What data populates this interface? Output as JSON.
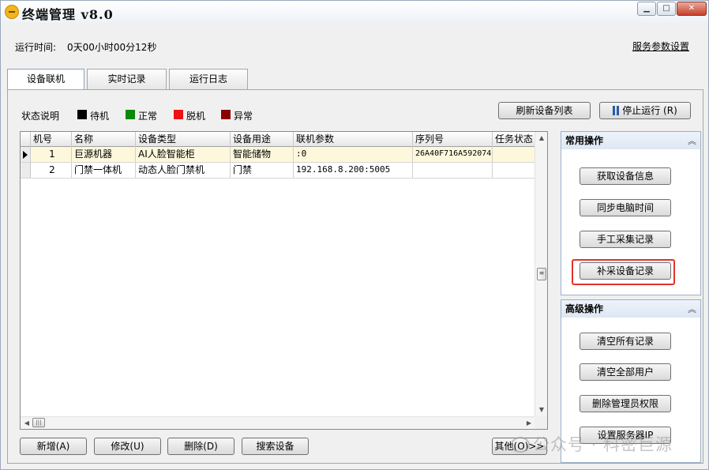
{
  "window": {
    "title": "终端管理 v8.0",
    "controls": [
      "minimize",
      "maximize",
      "close"
    ]
  },
  "status": {
    "runtime_label": "运行时间:",
    "runtime_value": "0天00小时00分12秒",
    "service_settings_link": "服务参数设置"
  },
  "tabs": [
    {
      "label": "设备联机",
      "active": true
    },
    {
      "label": "实时记录",
      "active": false
    },
    {
      "label": "运行日志",
      "active": false
    }
  ],
  "legend": {
    "title": "状态说明",
    "items": [
      {
        "label": "待机",
        "color": "#000000"
      },
      {
        "label": "正常",
        "color": "#0a8a0a"
      },
      {
        "label": "脱机",
        "color": "#ee1111"
      },
      {
        "label": "异常",
        "color": "#8b0000"
      }
    ]
  },
  "toolbar": {
    "refresh_label": "刷新设备列表",
    "stop_label": "停止运行 (R)"
  },
  "grid": {
    "columns": [
      "机号",
      "名称",
      "设备类型",
      "设备用途",
      "联机参数",
      "序列号",
      "任务状态"
    ],
    "rows": [
      {
        "id": "1",
        "name": "巨源机器",
        "type": "AI人脸智能柜",
        "usage": "智能储物",
        "param": ":0",
        "serial": "26A40F716A592074",
        "task": "",
        "selected": true
      },
      {
        "id": "2",
        "name": "门禁一体机",
        "type": "动态人脸门禁机",
        "usage": "门禁",
        "param": "192.168.8.200:5005",
        "serial": "",
        "task": "",
        "selected": false
      }
    ]
  },
  "side": {
    "common": {
      "title": "常用操作",
      "buttons": [
        "获取设备信息",
        "同步电脑时间",
        "手工采集记录",
        "补采设备记录"
      ],
      "highlighted": "补采设备记录"
    },
    "advanced": {
      "title": "高级操作",
      "buttons": [
        "清空所有记录",
        "清空全部用户",
        "删除管理员权限",
        "设置服务器IP"
      ]
    }
  },
  "bottom": {
    "add_label": "新增(A)",
    "edit_label": "修改(U)",
    "delete_label": "删除(D)",
    "search_label": "搜索设备",
    "other_label": "其他(O)>>"
  },
  "watermark": {
    "text": "公众号 · 科密巨源"
  },
  "colors": {
    "highlight": "#e3312a",
    "selected_row": "#fdf8dc"
  }
}
